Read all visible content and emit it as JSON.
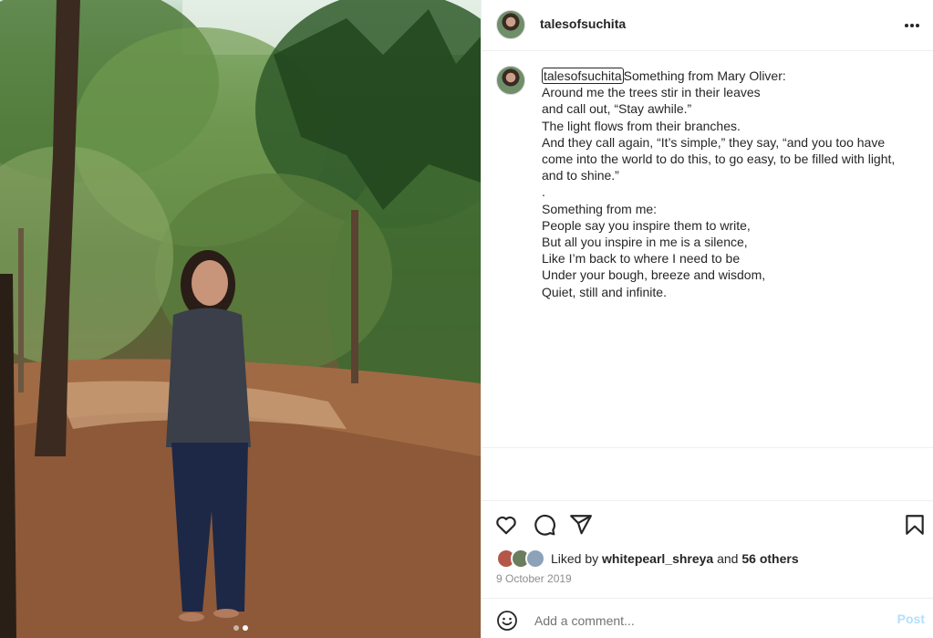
{
  "post": {
    "username": "talesofsuchita",
    "caption": {
      "username": "talesofsuchita",
      "first_line": "Something from Mary Oliver:",
      "lines": [
        "Around me the trees stir in their leaves",
        "and call out, “Stay awhile.”",
        "The light flows from their branches.",
        "And they call again, “It’s simple,” they say, “and you too have",
        "come into the world to do this, to go easy, to be filled with light,",
        "and to shine.”",
        ".",
        "Something from me:",
        "People say you inspire them to write,",
        "But all you inspire in me is a silence,",
        "Like I’m back to where I need to be",
        "Under your bough, breeze and wisdom,",
        "Quiet, still and infinite."
      ]
    },
    "likes": {
      "prefix": "Liked by",
      "liker": "whitepearl_shreya",
      "connector": "and",
      "others": "56 others"
    },
    "date": "9 October 2019"
  },
  "actions": {
    "like_icon": "heart-icon",
    "comment_icon": "comment-icon",
    "share_icon": "paper-plane-icon",
    "save_icon": "bookmark-icon",
    "more_icon": "more-horizontal-icon"
  },
  "comment_box": {
    "placeholder": "Add a comment...",
    "value": "",
    "post_label": "Post",
    "emoji_icon": "smiley-icon"
  },
  "colors": {
    "text": "#262626",
    "muted": "#8e8e8e",
    "post_disabled": "#b2dffc",
    "divider": "#efefef"
  }
}
